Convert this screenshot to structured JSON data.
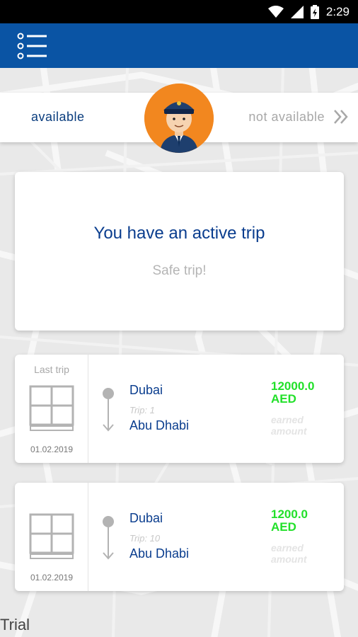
{
  "status_bar": {
    "time": "2:29"
  },
  "availability": {
    "available_label": "available",
    "not_available_label": "not available"
  },
  "active_trip": {
    "title": "You have an active trip",
    "subtitle": "Safe trip!"
  },
  "trips": [
    {
      "label": "Last trip",
      "date": "01.02.2019",
      "from": "Dubai",
      "trip_no": "Trip: 1",
      "to": "Abu Dhabi",
      "amount": "12000.0",
      "currency": "AED",
      "earned_label": "earned amount"
    },
    {
      "label": "",
      "date": "01.02.2019",
      "from": "Dubai",
      "trip_no": "Trip: 10",
      "to": "Abu Dhabi",
      "amount": "1200.0",
      "currency": "AED",
      "earned_label": "earned amount"
    }
  ],
  "watermark": "Trial",
  "colors": {
    "primary": "#0a54a4",
    "accent": "#f2871f",
    "earned": "#22e02a"
  }
}
